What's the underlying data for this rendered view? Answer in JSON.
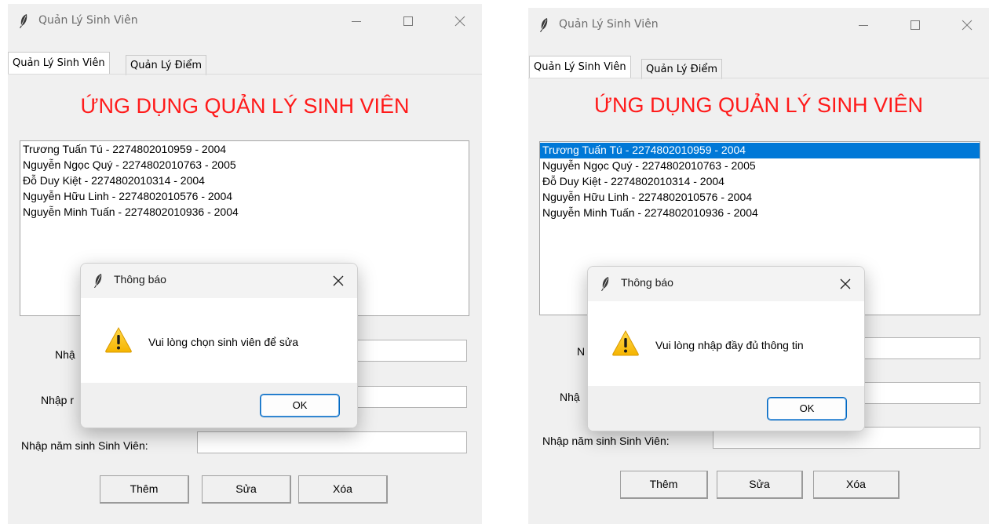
{
  "windows": [
    {
      "title": "Quản Lý Sinh Viên",
      "tabs": [
        "Quản Lý Sinh Viên",
        "Quản Lý Điểm"
      ],
      "app_title": "ỨNG DỤNG QUẢN LÝ SINH VIÊN",
      "students": [
        "Trương Tuấn Tú - 2274802010959 - 2004",
        "Nguyễn Ngọc Quý - 2274802010763 - 2005",
        "Đỗ Duy Kiệt - 2274802010314 - 2004",
        "Nguyễn Hữu Linh - 2274802010576 - 2004",
        "Nguyễn Minh Tuấn  - 2274802010936 - 2004"
      ],
      "labels": {
        "name_partial": "Nhậ",
        "id_partial": "Nhập r",
        "year": "Nhập năm sinh Sinh Viên:"
      },
      "buttons": {
        "add": "Thêm",
        "edit": "Sửa",
        "delete": "Xóa"
      },
      "dialog": {
        "title": "Thông báo",
        "message": "Vui lòng chọn sinh viên để sửa",
        "ok": "OK"
      }
    },
    {
      "title": "Quản Lý Sinh Viên",
      "tabs": [
        "Quản Lý Sinh Viên",
        "Quản Lý Điểm"
      ],
      "app_title": "ỨNG DỤNG QUẢN LÝ SINH VIÊN",
      "students": [
        "Trương Tuấn Tú - 2274802010959 - 2004",
        "Nguyễn Ngọc Quý - 2274802010763 - 2005",
        "Đỗ Duy Kiệt - 2274802010314 - 2004",
        "Nguyễn Hữu Linh - 2274802010576 - 2004",
        "Nguyễn Minh Tuấn  - 2274802010936 - 2004"
      ],
      "selected_index": 0,
      "labels": {
        "name_partial": "N",
        "id_partial": "Nhậ",
        "year": "Nhập năm sinh Sinh Viên:"
      },
      "buttons": {
        "add": "Thêm",
        "edit": "Sửa",
        "delete": "Xóa"
      },
      "dialog": {
        "title": "Thông báo",
        "message": "Vui lòng nhập đầy đủ thông tin",
        "ok": "OK"
      }
    }
  ],
  "colors": {
    "title_red": "#ff1a1a",
    "selection_blue": "#0078d7",
    "ok_border": "#0067c0",
    "window_bg": "#f0f0f0"
  },
  "icons": {
    "app": "feather-icon",
    "warning": "warning-icon"
  }
}
